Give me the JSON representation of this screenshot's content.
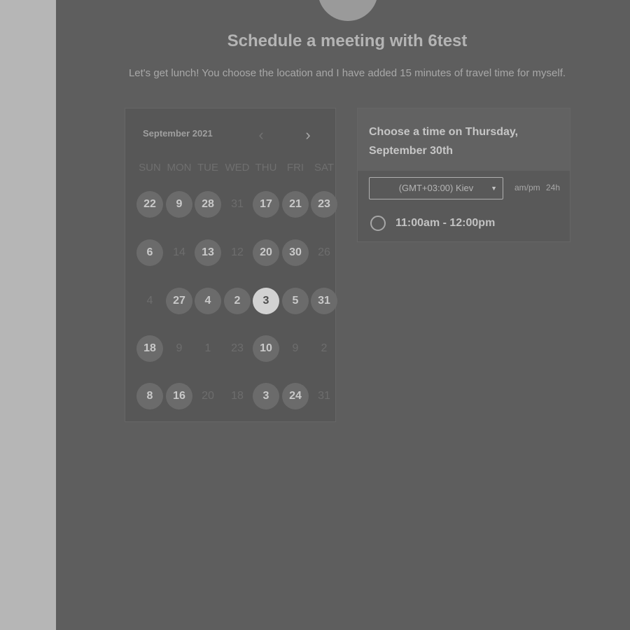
{
  "header": {
    "title": "Schedule a meeting with 6test",
    "subtitle": "Let's get lunch! You choose the location and I have added 15 minutes of travel time for myself."
  },
  "calendar": {
    "month_label": "September 2021",
    "prev_icon": "chevron-left-icon",
    "next_icon": "chevron-right-icon",
    "weekdays": [
      "SUN",
      "MON",
      "TUE",
      "WED",
      "THU",
      "FRI",
      "SAT"
    ],
    "weeks": [
      [
        {
          "d": "22",
          "s": "avail"
        },
        {
          "d": "9",
          "s": "avail"
        },
        {
          "d": "28",
          "s": "avail"
        },
        {
          "d": "31",
          "s": "unavail"
        },
        {
          "d": "17",
          "s": "avail"
        },
        {
          "d": "21",
          "s": "avail"
        },
        {
          "d": "23",
          "s": "avail"
        }
      ],
      [
        {
          "d": "6",
          "s": "avail"
        },
        {
          "d": "14",
          "s": "unavail"
        },
        {
          "d": "13",
          "s": "avail"
        },
        {
          "d": "12",
          "s": "unavail"
        },
        {
          "d": "20",
          "s": "avail"
        },
        {
          "d": "30",
          "s": "avail"
        },
        {
          "d": "26",
          "s": "unavail"
        }
      ],
      [
        {
          "d": "4",
          "s": "unavail"
        },
        {
          "d": "27",
          "s": "avail"
        },
        {
          "d": "4",
          "s": "avail"
        },
        {
          "d": "2",
          "s": "avail"
        },
        {
          "d": "3",
          "s": "selected"
        },
        {
          "d": "5",
          "s": "avail"
        },
        {
          "d": "31",
          "s": "avail"
        }
      ],
      [
        {
          "d": "18",
          "s": "avail"
        },
        {
          "d": "9",
          "s": "unavail"
        },
        {
          "d": "1",
          "s": "unavail"
        },
        {
          "d": "23",
          "s": "unavail"
        },
        {
          "d": "10",
          "s": "avail"
        },
        {
          "d": "9",
          "s": "unavail"
        },
        {
          "d": "2",
          "s": "unavail"
        }
      ],
      [
        {
          "d": "8",
          "s": "avail"
        },
        {
          "d": "16",
          "s": "avail"
        },
        {
          "d": "20",
          "s": "unavail"
        },
        {
          "d": "18",
          "s": "unavail"
        },
        {
          "d": "3",
          "s": "avail"
        },
        {
          "d": "24",
          "s": "avail"
        },
        {
          "d": "31",
          "s": "unavail"
        }
      ]
    ]
  },
  "time_panel": {
    "heading": "Choose a time on Thursday, September 30th",
    "timezone": "(GMT+03:00) Kiev",
    "format_ampm": "am/pm",
    "format_24h": "24h",
    "slots": [
      "11:00am - 12:00pm"
    ]
  }
}
